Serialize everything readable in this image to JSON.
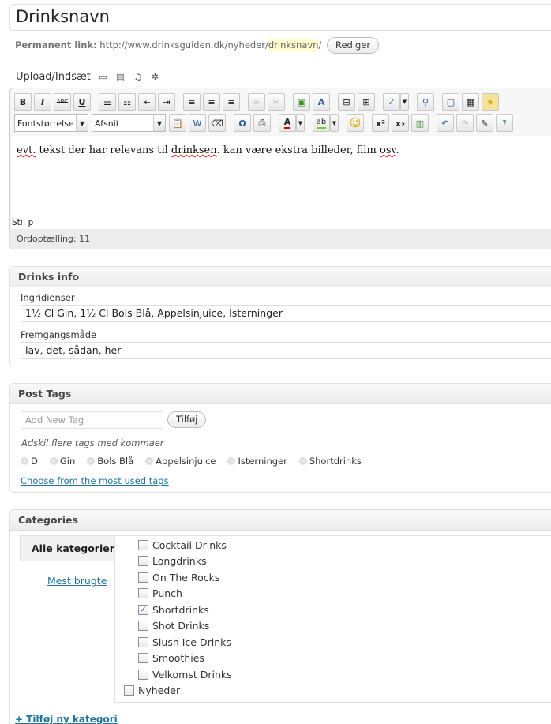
{
  "title": {
    "value": "Drinksnavn"
  },
  "permalink": {
    "label": "Permanent link:",
    "base": "http://www.drinksguiden.dk/nyheder/",
    "slug": "drinksnavn",
    "trail": "/",
    "edit_button": "Rediger"
  },
  "upload": {
    "label": "Upload/Indsæt",
    "icons": [
      "image-icon",
      "video-icon",
      "audio-icon",
      "media-icon"
    ]
  },
  "editor": {
    "toolbar_row1": [
      "bold-icon",
      "italic-icon",
      "strikethrough-icon",
      "underline-icon",
      "bullet-list-icon",
      "numbered-list-icon",
      "outdent-icon",
      "indent-icon",
      "align-left-icon",
      "align-center-icon",
      "align-right-icon",
      "link-icon",
      "unlink-icon",
      "image-insert-icon",
      "style-icon",
      "insert-anchor-icon",
      "page-break-icon",
      "spellcheck-icon",
      "find-replace-icon",
      "fullscreen-icon",
      "kitchen-sink-icon",
      "star-icon"
    ],
    "font_size_select": "Fontstørrelse",
    "format_select": "Afsnit",
    "toolbar_row2": [
      "paste-text-icon",
      "paste-word-icon",
      "clear-formatting-icon",
      "omega-icon",
      "print-icon",
      "text-color-icon",
      "highlight-icon",
      "smiley-icon",
      "superscript-icon",
      "subscript-icon",
      "media-film-icon",
      "undo-icon",
      "redo-icon",
      "advanced-icon",
      "help-icon"
    ],
    "text_segments": [
      "evt.",
      " tekst der har relevans til ",
      "drinksen",
      ". kan være ekstra billeder, film ",
      "osv",
      "."
    ],
    "path": "Sti: p",
    "word_count": "Ordoptælling: 11"
  },
  "drinks_info": {
    "heading": "Drinks info",
    "ingredients_label": "Ingridienser",
    "ingredients_value": "1½ Cl Gin, 1½ Cl Bols Blå, Appelsinjuice, Isterninger",
    "method_label": "Fremgangsmåde",
    "method_value": "lav, det, sådan, her"
  },
  "post_tags": {
    "heading": "Post Tags",
    "placeholder": "Add New Tag",
    "add_button": "Tilføj",
    "hint": "Adskil flere tags med kommaer",
    "tags": [
      "D",
      "Gin",
      "Bols Blå",
      "Appelsinjuice",
      "Isterninger",
      "Shortdrinks"
    ],
    "most_used_link": "Choose from the most used tags"
  },
  "categories": {
    "heading": "Categories",
    "tab_all": "Alle kategorier",
    "tab_most_used": "Mest brugte",
    "items": [
      {
        "label": "Cocktail Drinks",
        "checked": false,
        "level": 1
      },
      {
        "label": "Longdrinks",
        "checked": false,
        "level": 1
      },
      {
        "label": "On The Rocks",
        "checked": false,
        "level": 1
      },
      {
        "label": "Punch",
        "checked": false,
        "level": 1
      },
      {
        "label": "Shortdrinks",
        "checked": true,
        "level": 1
      },
      {
        "label": "Shot Drinks",
        "checked": false,
        "level": 1
      },
      {
        "label": "Slush Ice Drinks",
        "checked": false,
        "level": 1
      },
      {
        "label": "Smoothies",
        "checked": false,
        "level": 1
      },
      {
        "label": "Velkomst Drinks",
        "checked": false,
        "level": 1
      },
      {
        "label": "Nyheder",
        "checked": false,
        "level": 0
      }
    ],
    "add_new": "+ Tilføj ny kategori"
  },
  "colors": {
    "link": "#21759b",
    "header_bg": "#ececec",
    "border": "#dfdfdf",
    "spell_underline": "#dd2222"
  }
}
